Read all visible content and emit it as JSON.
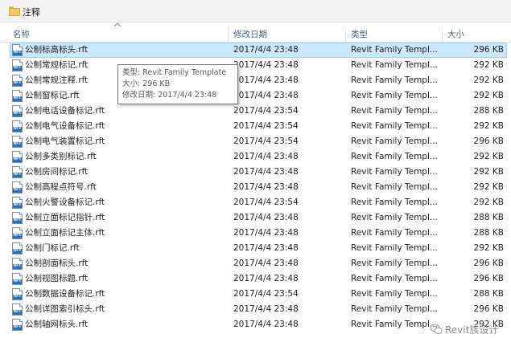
{
  "window": {
    "title": "注释"
  },
  "columns": {
    "name": "名称",
    "date": "修改日期",
    "type": "类型",
    "size": "大小"
  },
  "files": [
    {
      "name": "公制标高标头.rft",
      "date": "2017/4/4 23:48",
      "type": "Revit Family Templ...",
      "size": "296 KB",
      "selected": true
    },
    {
      "name": "公制常规标记.rft",
      "date": "2017/4/4 23:48",
      "type": "Revit Family Templ...",
      "size": "292 KB"
    },
    {
      "name": "公制常规注释.rft",
      "date": "2017/4/4 23:48",
      "type": "Revit Family Templ...",
      "size": "292 KB"
    },
    {
      "name": "公制窗标记.rft",
      "date": "2017/4/4 23:48",
      "type": "Revit Family Templ...",
      "size": "292 KB"
    },
    {
      "name": "公制电话设备标记.rft",
      "date": "2017/4/4 23:54",
      "type": "Revit Family Templ...",
      "size": "288 KB"
    },
    {
      "name": "公制电气设备标记.rft",
      "date": "2017/4/4 23:54",
      "type": "Revit Family Templ...",
      "size": "292 KB"
    },
    {
      "name": "公制电气装置标记.rft",
      "date": "2017/4/4 23:54",
      "type": "Revit Family Templ...",
      "size": "296 KB"
    },
    {
      "name": "公制多类别标记.rft",
      "date": "2017/4/4 23:48",
      "type": "Revit Family Templ...",
      "size": "292 KB"
    },
    {
      "name": "公制房间标记.rft",
      "date": "2017/4/4 23:48",
      "type": "Revit Family Templ...",
      "size": "292 KB"
    },
    {
      "name": "公制高程点符号.rft",
      "date": "2017/4/4 23:48",
      "type": "Revit Family Templ...",
      "size": "292 KB"
    },
    {
      "name": "公制火警设备标记.rft",
      "date": "2017/4/4 23:54",
      "type": "Revit Family Templ...",
      "size": "292 KB"
    },
    {
      "name": "公制立面标记指针.rft",
      "date": "2017/4/4 23:48",
      "type": "Revit Family Templ...",
      "size": "288 KB"
    },
    {
      "name": "公制立面标记主体.rft",
      "date": "2017/4/4 23:48",
      "type": "Revit Family Templ...",
      "size": "288 KB"
    },
    {
      "name": "公制门标记.rft",
      "date": "2017/4/4 23:48",
      "type": "Revit Family Templ...",
      "size": "292 KB"
    },
    {
      "name": "公制剖面标头.rft",
      "date": "2017/4/4 23:48",
      "type": "Revit Family Templ...",
      "size": "296 KB"
    },
    {
      "name": "公制视图标题.rft",
      "date": "2017/4/4 23:48",
      "type": "Revit Family Templ...",
      "size": "296 KB"
    },
    {
      "name": "公制数据设备标记.rft",
      "date": "2017/4/4 23:54",
      "type": "Revit Family Templ...",
      "size": "288 KB"
    },
    {
      "name": "公制详图索引标头.rft",
      "date": "2017/4/4 23:48",
      "type": "Revit Family Templ...",
      "size": "296 KB"
    },
    {
      "name": "公制轴网标头.rft",
      "date": "2017/4/4 23:48",
      "type": "Revit Family Templ...",
      "size": "292 KB"
    }
  ],
  "tooltip": {
    "type_line": "类型: Revit Family Template",
    "size_line": "大小: 296 KB",
    "date_line": "修改日期: 2017/4/4 23:48"
  },
  "watermark": {
    "text": "Revit族设计"
  },
  "icons": {
    "folder": "folder-icon",
    "file": "rft-file-icon",
    "sort": "sort-up-icon",
    "watermark": "wechat-icon"
  },
  "colors": {
    "selection": "#cce8ff",
    "selection_border": "#99d1ff",
    "header_text": "#4c607a"
  }
}
